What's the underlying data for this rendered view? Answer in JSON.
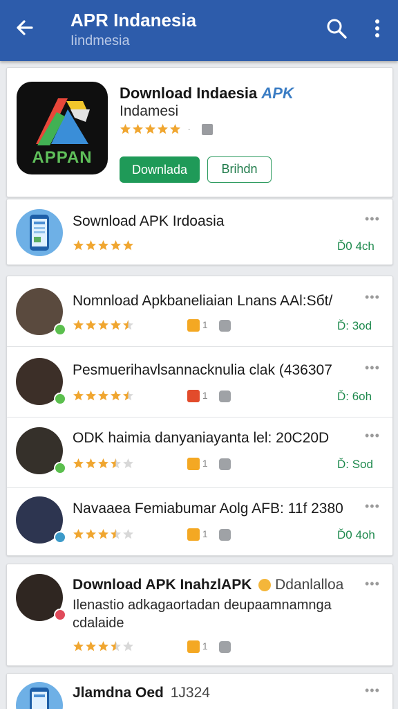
{
  "appbar": {
    "title": "APR Indanesia",
    "subtitle": "Iindmesia",
    "back_icon": "arrow-left-icon",
    "search_icon": "search-icon",
    "more_icon": "more-vertical-icon",
    "color": "#2d5cab"
  },
  "hero": {
    "icon_text": "APPAN",
    "title": "Download Indaesia",
    "title_badge": "APK",
    "subtitle": "Indamesi",
    "rating_stars": 5,
    "rating_suffix": "·",
    "download_button": "Downlada",
    "secondary_button": "Brihdn",
    "accent": "#1f9a58"
  },
  "featured": {
    "title": "Sownload APK Irdoasia",
    "rating": 5,
    "download_info": "Ď0 4ch",
    "more": "•••"
  },
  "list": [
    {
      "title": "Nomnload Apkbaneliaian Lnans AAl:Sбt/",
      "rating": 4.5,
      "lock_color": "#f4a823",
      "count": "1",
      "download_info": "Ď: 3od",
      "avatar_color": "#5a4a3e",
      "badge_color": "#5bbf4e",
      "more": "•••"
    },
    {
      "title": "Pesmuerihavlsannacknulia clak (436307",
      "rating": 4.5,
      "lock_color": "#e24b2b",
      "count": "1",
      "download_info": "Ď: 6oh",
      "avatar_color": "#3c2f28",
      "badge_color": "#5bbf4e",
      "more": "•••"
    },
    {
      "title": "ODK haimia danyaniayanta lel: 20С20D",
      "rating": 3.5,
      "lock_color": "#f4a823",
      "count": "1",
      "download_info": "Ď: Sod",
      "avatar_color": "#35302a",
      "badge_color": "#5bbf4e",
      "more": "•••"
    },
    {
      "title": "Navaaea Femiabumar Aolg AFB: 11f 2380",
      "rating": 3.5,
      "lock_color": "#f4a823",
      "count": "1",
      "download_info": "Ď0 4oh",
      "avatar_color": "#2d3550",
      "badge_color": "#3c9ac9",
      "more": "•••"
    }
  ],
  "promo": {
    "title": "Download APK InahzlAPK",
    "title_extra": "Ddanlalloa",
    "line2": "Ilenastio adkagaortadan deupaamnamnga",
    "line3": "cdalaide",
    "rating": 3.5,
    "count": "1",
    "more": "•••",
    "avatar_color": "#2f2621",
    "badge_color": "#e04a5a"
  },
  "bottom": {
    "title": "Jlamdna Oed",
    "title_extra": "1J324",
    "more": "•••"
  }
}
